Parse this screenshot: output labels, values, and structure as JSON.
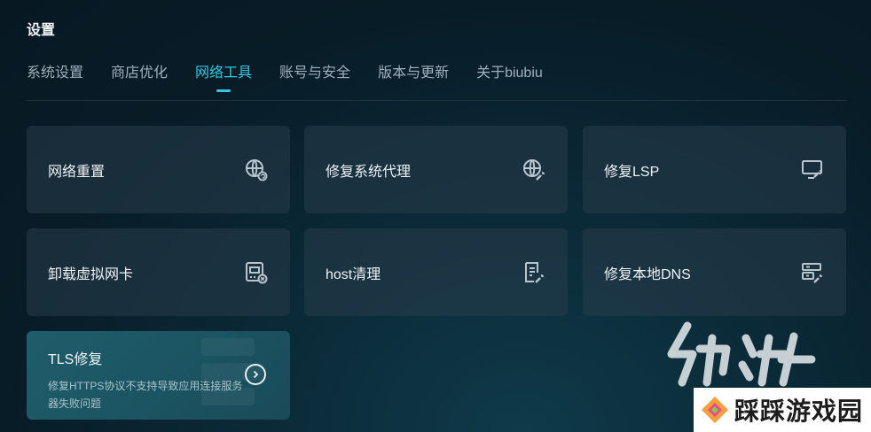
{
  "header": {
    "title": "设置"
  },
  "tabs": [
    {
      "label": "系统设置",
      "active": false
    },
    {
      "label": "商店优化",
      "active": false
    },
    {
      "label": "网络工具",
      "active": true
    },
    {
      "label": "账号与安全",
      "active": false
    },
    {
      "label": "版本与更新",
      "active": false
    },
    {
      "label": "关于biubiu",
      "active": false
    }
  ],
  "tools": [
    {
      "label": "网络重置",
      "icon": "globe-refresh-icon"
    },
    {
      "label": "修复系统代理",
      "icon": "globe-wrench-icon"
    },
    {
      "label": "修复LSP",
      "icon": "monitor-wrench-icon"
    },
    {
      "label": "卸载虚拟网卡",
      "icon": "network-card-remove-icon"
    },
    {
      "label": "host清理",
      "icon": "document-clean-icon"
    },
    {
      "label": "修复本地DNS",
      "icon": "server-wrench-icon"
    }
  ],
  "tls": {
    "title": "TLS修复",
    "description": "修复HTTPS协议不支持导致应用连接服务器失败问题",
    "action_icon": "chevron-right-circle-icon"
  },
  "watermark": {
    "logo_text": "九游",
    "site_name": "踩踩游戏园"
  },
  "colors": {
    "accent": "#34c7e4",
    "background": "#0b2532",
    "card": "#1e3442",
    "tls_card": "#1d5664"
  }
}
